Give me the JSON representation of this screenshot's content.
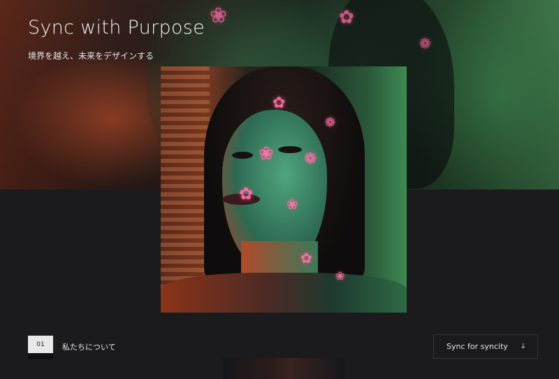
{
  "hero": {
    "title": "Sync with Purpose",
    "subtitle": "境界を越え、未来をデザインする"
  },
  "section": {
    "number": "01",
    "label": "私たちについて"
  },
  "cta": {
    "label": "Sync for syncity",
    "icon": "arrow-down-icon"
  },
  "colors": {
    "background": "#1b1b1e",
    "text": "#f3f3f3",
    "number_badge": "#e8e8e8"
  }
}
